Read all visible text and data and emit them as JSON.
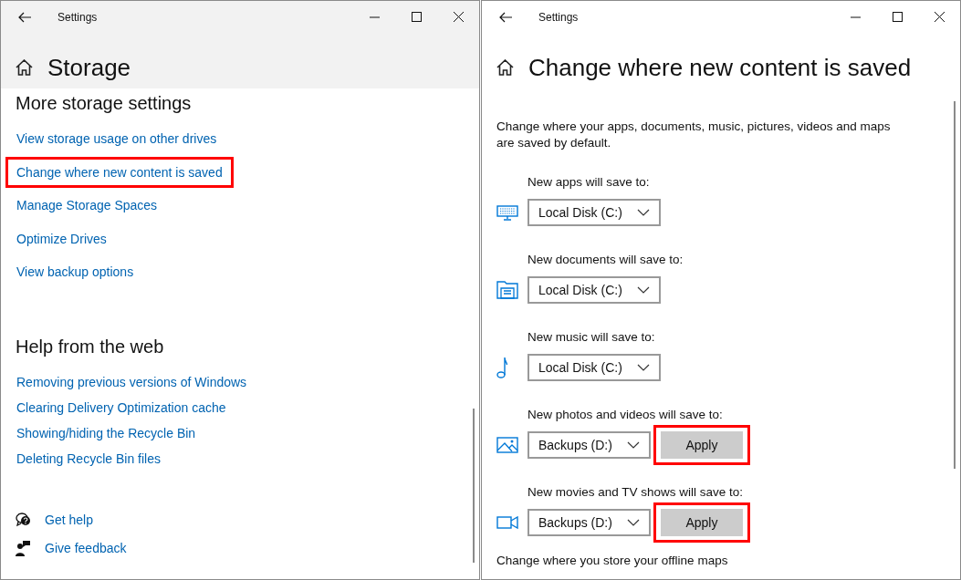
{
  "windows": [
    {
      "kind": "storage",
      "title": "Settings",
      "heading": "Storage",
      "sections": [
        {
          "kind": "spaced",
          "heading": "More storage settings",
          "links": [
            {
              "text": "View storage usage on other drives",
              "highlighted": false
            },
            {
              "text": "Change where new content is saved",
              "highlighted": true
            },
            {
              "text": "Manage Storage Spaces",
              "highlighted": false
            },
            {
              "text": "Optimize Drives",
              "highlighted": false
            },
            {
              "text": "View backup options",
              "highlighted": false
            }
          ]
        },
        {
          "kind": "compact",
          "heading": "Help from the web",
          "links": [
            {
              "text": "Removing previous versions of Windows",
              "highlighted": false
            },
            {
              "text": "Clearing Delivery Optimization cache",
              "highlighted": false
            },
            {
              "text": "Showing/hiding the Recycle Bin",
              "highlighted": false
            },
            {
              "text": "Deleting Recycle Bin files",
              "highlighted": false
            }
          ]
        }
      ],
      "footer_links": [
        {
          "kind": "help",
          "text": "Get help"
        },
        {
          "kind": "feedback",
          "text": "Give feedback"
        }
      ]
    },
    {
      "kind": "save_locations",
      "title": "Settings",
      "heading": "Change where new content is saved",
      "description": "Change where your apps, documents, music, pictures, videos and maps are saved by default.",
      "locations": [
        {
          "kind": "apps",
          "label": "New apps will save to:",
          "drive": "Local Disk (C:)"
        },
        {
          "kind": "documents",
          "label": "New documents will save to:",
          "drive": "Local Disk (C:)"
        },
        {
          "kind": "music",
          "label": "New music will save to:",
          "drive": "Local Disk (C:)"
        },
        {
          "kind": "photos",
          "label": "New photos and videos will save to:",
          "drive": "Backups (D:)",
          "apply": {
            "label": "Apply",
            "highlighted": true
          }
        },
        {
          "kind": "movies",
          "label": "New movies and TV shows will save to:",
          "drive": "Backups (D:)",
          "apply": {
            "label": "Apply",
            "highlighted": true
          }
        }
      ],
      "footer_text": "Change where you store your offline maps"
    }
  ]
}
